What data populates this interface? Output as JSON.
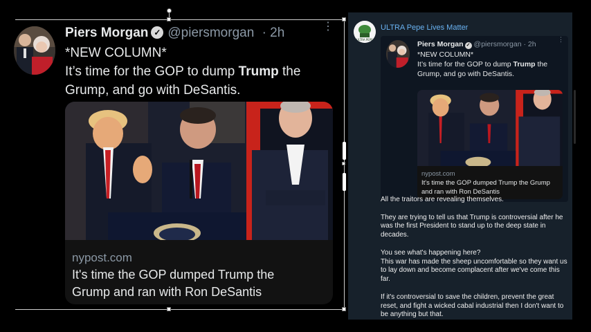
{
  "left_tweet": {
    "name": "Piers Morgan",
    "verified_mark": "✓",
    "handle": "@piersmorgan",
    "time": "· 2h",
    "more": "⋮",
    "line1": "*NEW COLUMN*",
    "line2_pre": "It’s time for the GOP to dump ",
    "line2_bold": "Trump",
    "line2_post": " the Grump, and go with DeSantis.",
    "card_domain": "nypost.com",
    "card_title": "It's time the GOP dumped Trump the Grump and ran with Ron DeSantis"
  },
  "right_post": {
    "channel": "ULTRA Pepe Lives Matter",
    "avatar_text": "ULTRA PEPE",
    "embedded": {
      "name": "Piers Morgan",
      "verified_mark": "✓",
      "handle": "@piersmorgan · 2h",
      "more": "⋮",
      "line1": "*NEW COLUMN*",
      "line2_pre": "It’s time for the GOP to dump ",
      "line2_bold": "Trump",
      "line2_post": " the Grump, and go with DeSantis.",
      "card_domain": "nypost.com",
      "card_title": "It's time the GOP dumped Trump the Grump and ran with Ron DeSantis"
    },
    "body": {
      "p1": "All the traitors are revealing themselves.",
      "p2": "They are trying to tell us that Trump is controversial after he was the first President to stand up to the deep state in decades.",
      "p3a": "You see what's happening here?",
      "p3b": "This war has made the sheep uncomfortable so they want us to lay down and become complacent after we've come this far.",
      "p4": "If it's controversial to save the children, prevent the great reset, and fight a wicked cabal industrial then I don't want to be anything but that."
    }
  },
  "colors": {
    "background": "#000000",
    "telegram_panel": "#17212b",
    "telegram_inner": "#0e1621",
    "channel_name": "#6ab3f3",
    "muted_text": "#8b98a5"
  },
  "icons": [
    "verified-badge-icon",
    "more-options-icon",
    "channel-avatar-icon"
  ]
}
